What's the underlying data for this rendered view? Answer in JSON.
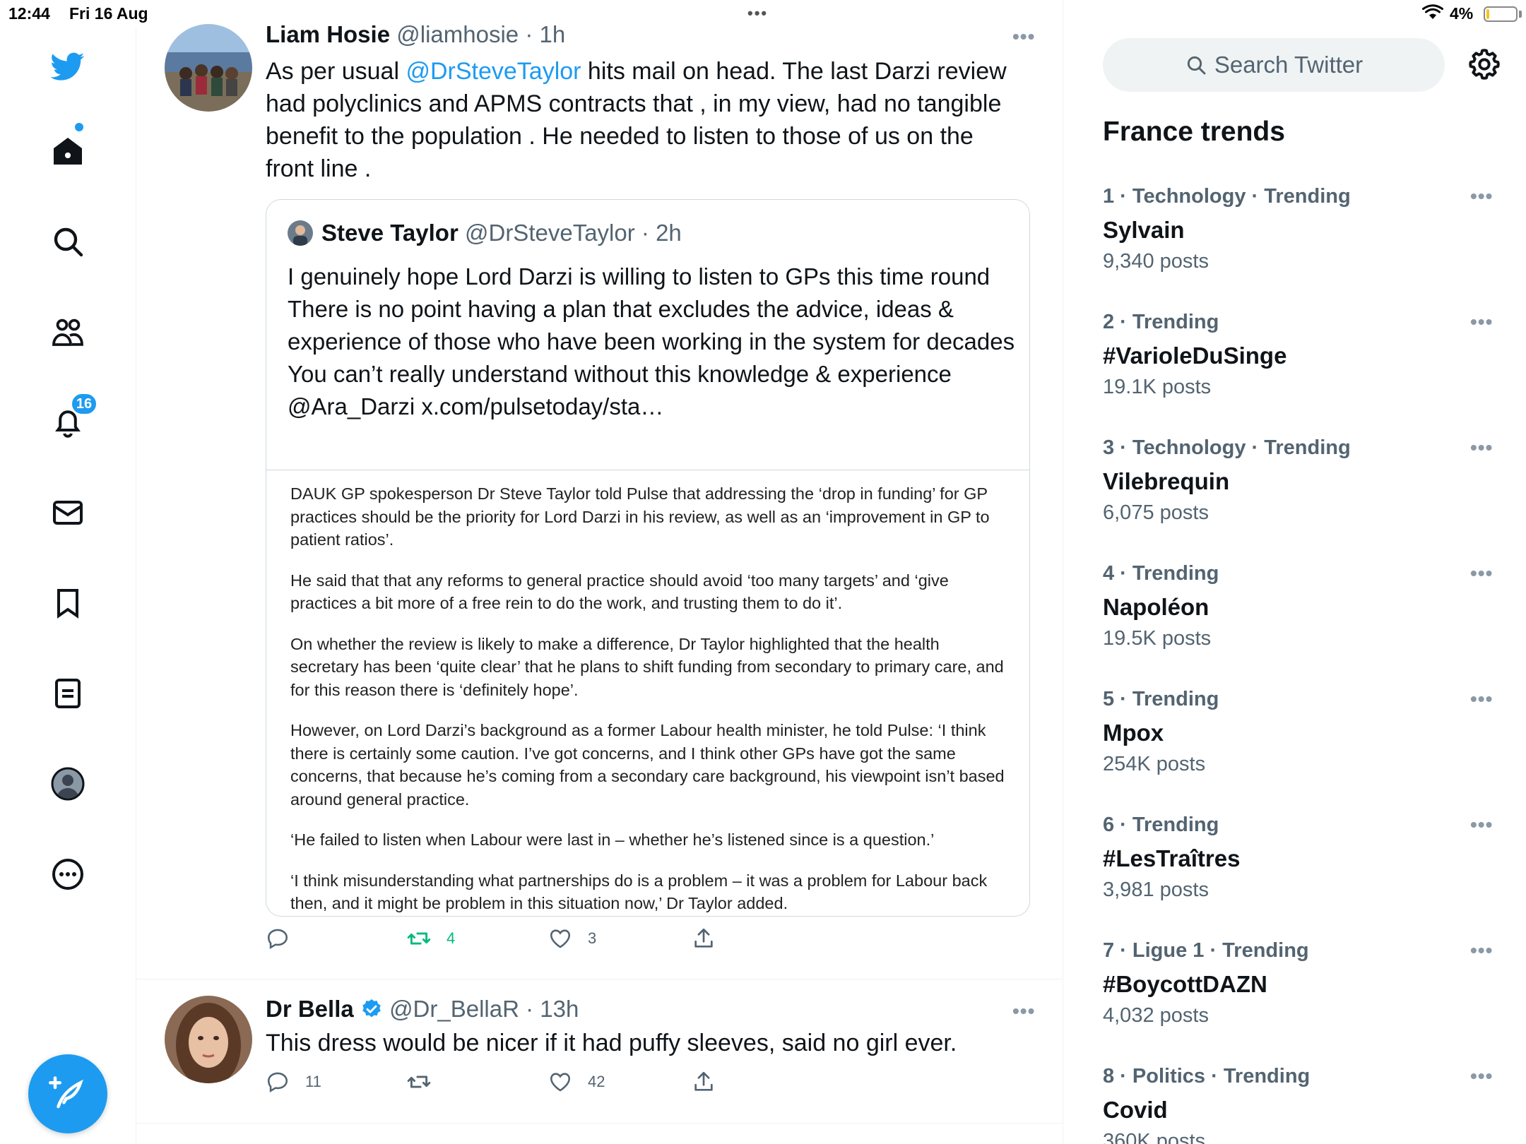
{
  "status_bar": {
    "time": "12:44",
    "date": "Fri 16 Aug",
    "multitask": "•••",
    "battery_text": "4%",
    "battery_level": 0.04
  },
  "nav": {
    "icons": [
      "twitter-logo-icon",
      "home-icon",
      "search-icon",
      "communities-icon",
      "notifications-icon",
      "messages-icon",
      "bookmarks-icon",
      "lists-icon",
      "profile-icon",
      "more-icon"
    ],
    "notifications_badge": "16",
    "compose_icon": "compose-tweet-icon"
  },
  "tweets": [
    {
      "name": "Liam Hosie",
      "handle": "@liamhosie",
      "sep": "·",
      "time": "1h",
      "more": "•••",
      "body_pre": "As per usual ",
      "body_mention": "@DrSteveTaylor",
      "body_post": " hits mail on head. The last Darzi review had polyclinics and APMS contracts that , in my view, had no tangible benefit to the population . He needed to listen to those of us on the front line .",
      "quote": {
        "name": "Steve Taylor",
        "handle": "@DrSteveTaylor",
        "sep": "·",
        "time": "2h",
        "body": "I genuinely hope Lord Darzi is willing to listen to GPs this time round\nThere is no point having a plan that excludes the advice, ideas & experience of those who have been working in the system for decades\nYou can’t really understand without this knowledge & experience\n@Ara_Darzi x.com/pulsetoday/sta…",
        "article": [
          "DAUK GP spokesperson Dr Steve Taylor told Pulse that addressing the ‘drop in funding’ for GP practices should be the priority for Lord Darzi in his review, as well as an ‘improvement in GP to patient ratios’.",
          "He said that that any reforms to general practice should avoid ‘too many targets’ and ‘give practices a bit more of a free rein to do the work, and trusting them to do it’.",
          "On whether the review is likely to make a difference, Dr Taylor highlighted that the health secretary has been ‘quite clear’ that he plans to shift funding from secondary to primary care, and for this reason there is ‘definitely hope’.",
          "However, on Lord Darzi’s background as a former Labour health minister, he told Pulse: ‘I think there is certainly some caution. I’ve got concerns, and I think other GPs have got the same concerns, that because he’s coming from a secondary care background, his viewpoint isn’t based around general practice.",
          "‘He failed to listen when Labour were last in – whether he’s listened since is a question.’",
          "‘I think misunderstanding what partnerships do is a problem – it was a problem for Labour back then, and it might be problem in this situation now,’ Dr Taylor added."
        ]
      },
      "replies": "",
      "retweets": "4",
      "likes": "3"
    },
    {
      "name": "Dr Bella",
      "handle": "@Dr_BellaR",
      "sep": "·",
      "time": "13h",
      "more": "•••",
      "verified": true,
      "body": "This dress would be nicer if it had puffy sleeves, said no girl ever.",
      "replies": "11",
      "retweets": "",
      "likes": "42"
    }
  ],
  "sidebar": {
    "search_placeholder": "Search Twitter",
    "trends_title": "France trends",
    "trends": [
      {
        "meta": "1 · Technology · Trending",
        "name": "Sylvain",
        "count": "9,340 posts"
      },
      {
        "meta": "2 · Trending",
        "name": "#VarioleDuSinge",
        "count": "19.1K posts"
      },
      {
        "meta": "3 · Technology · Trending",
        "name": "Vilebrequin",
        "count": "6,075 posts"
      },
      {
        "meta": "4 · Trending",
        "name": "Napoléon",
        "count": "19.5K posts"
      },
      {
        "meta": "5 · Trending",
        "name": "Mpox",
        "count": "254K posts"
      },
      {
        "meta": "6 · Trending",
        "name": "#LesTraîtres",
        "count": "3,981 posts"
      },
      {
        "meta": "7 · Ligue 1 · Trending",
        "name": "#BoycottDAZN",
        "count": "4,032 posts"
      },
      {
        "meta": "8 · Politics · Trending",
        "name": "Covid",
        "count": "360K posts"
      }
    ],
    "trend_more": "•••"
  },
  "colors": {
    "accent": "#1d9bf0",
    "retweet_green": "#00ba7c",
    "secondary_text": "#536471"
  }
}
